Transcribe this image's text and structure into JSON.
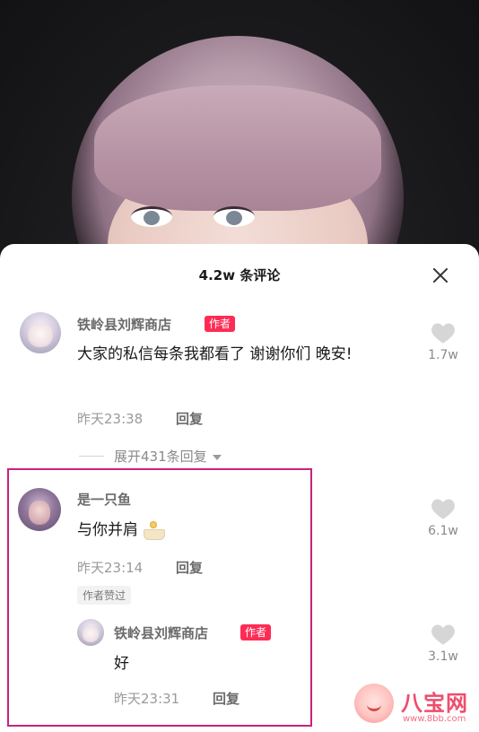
{
  "panel": {
    "title": "4.2w 条评论"
  },
  "comments": [
    {
      "username": "铁岭县刘辉商店",
      "author_tag": "作者",
      "text": "大家的私信每条我都看了 谢谢你们 晚安!",
      "time": "昨天23:38",
      "reply_label": "回复",
      "likes": "1.7w",
      "expand_label": "展开431条回复"
    },
    {
      "username": "是一只鱼",
      "text": "与你并肩",
      "time": "昨天23:14",
      "reply_label": "回复",
      "likes": "6.1w",
      "liked_by_author": "作者赞过",
      "reply": {
        "username": "铁岭县刘辉商店",
        "author_tag": "作者",
        "text": "好",
        "time": "昨天23:31",
        "reply_label": "回复",
        "likes": "3.1w"
      }
    }
  ],
  "watermark": {
    "name": "八宝网",
    "url": "www.8bb.com"
  },
  "colors": {
    "author_tag": "#fe2c55",
    "highlight_border": "#c8237d"
  }
}
